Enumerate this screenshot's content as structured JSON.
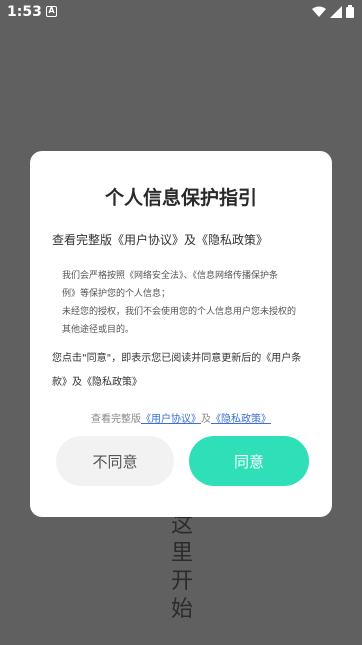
{
  "status_bar": {
    "time": "1:53",
    "app_icon_letter": "A",
    "icons": [
      "wifi-icon",
      "signal-icon",
      "battery-icon"
    ]
  },
  "background": {
    "vertical_text": [
      "这",
      "里",
      "开",
      "始"
    ]
  },
  "dialog": {
    "title": "个人信息保护指引",
    "subtitle": "查看完整版《用户协议》及《隐私政策》",
    "body_lines": [
      "我们会严格按照《网络安全法》、《信息网络传播保护条",
      "例》等保护您的个人信息；",
      "未经您的授权，我们不会使用您的个人信息用户您未授权的",
      "其他途径或目的。"
    ],
    "consent_text": "您点击\"同意\"，即表示您已阅读并同意更新后的《用户条款》及《隐私政策》",
    "footer_prefix": "查看完整版",
    "footer_link_agreement": "《用户协议》",
    "footer_and": "及",
    "footer_link_privacy": "《隐私政策》",
    "disagree_label": "不同意",
    "agree_label": "同意"
  },
  "colors": {
    "overlay": "#5f605f",
    "accent": "#2fdfb8",
    "link": "#3a6fd8"
  }
}
